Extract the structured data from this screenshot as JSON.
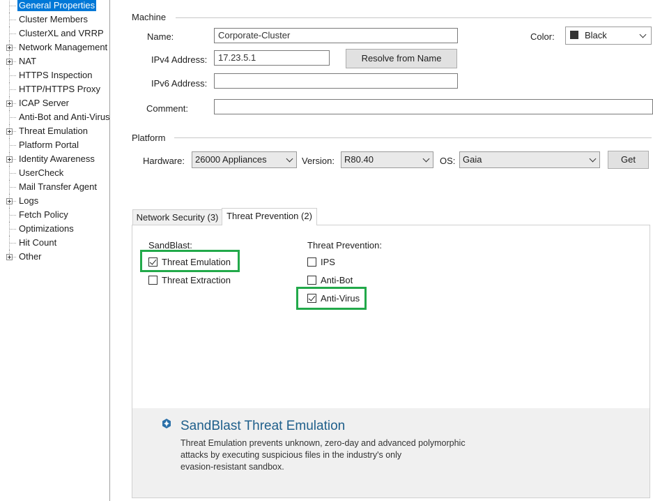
{
  "tree": {
    "items": [
      {
        "label": "General Properties",
        "selected": true,
        "expandable": false
      },
      {
        "label": "Cluster Members",
        "selected": false,
        "expandable": false
      },
      {
        "label": "ClusterXL and VRRP",
        "selected": false,
        "expandable": false
      },
      {
        "label": "Network Management",
        "selected": false,
        "expandable": true
      },
      {
        "label": "NAT",
        "selected": false,
        "expandable": true
      },
      {
        "label": "HTTPS Inspection",
        "selected": false,
        "expandable": false
      },
      {
        "label": "HTTP/HTTPS Proxy",
        "selected": false,
        "expandable": false
      },
      {
        "label": "ICAP Server",
        "selected": false,
        "expandable": true
      },
      {
        "label": "Anti-Bot and Anti-Virus",
        "selected": false,
        "expandable": false
      },
      {
        "label": "Threat Emulation",
        "selected": false,
        "expandable": true
      },
      {
        "label": "Platform Portal",
        "selected": false,
        "expandable": false
      },
      {
        "label": "Identity Awareness",
        "selected": false,
        "expandable": true
      },
      {
        "label": "UserCheck",
        "selected": false,
        "expandable": false
      },
      {
        "label": "Mail Transfer Agent",
        "selected": false,
        "expandable": false
      },
      {
        "label": "Logs",
        "selected": false,
        "expandable": true
      },
      {
        "label": "Fetch Policy",
        "selected": false,
        "expandable": false
      },
      {
        "label": "Optimizations",
        "selected": false,
        "expandable": false
      },
      {
        "label": "Hit Count",
        "selected": false,
        "expandable": false
      },
      {
        "label": "Other",
        "selected": false,
        "expandable": true
      }
    ]
  },
  "machine": {
    "section_title": "Machine",
    "name_label": "Name:",
    "name_value": "Corporate-Cluster",
    "ipv4_label": "IPv4 Address:",
    "ipv4_value": "17.23.5.1",
    "resolve_button": "Resolve from Name",
    "ipv6_label": "IPv6 Address:",
    "ipv6_value": "",
    "comment_label": "Comment:",
    "comment_value": "",
    "color_label": "Color:",
    "color_value": "Black",
    "color_swatch": "#333333"
  },
  "platform": {
    "section_title": "Platform",
    "hardware_label": "Hardware:",
    "hardware_value": "26000 Appliances",
    "version_label": "Version:",
    "version_value": "R80.40",
    "os_label": "OS:",
    "os_value": "Gaia",
    "get_button": "Get"
  },
  "tabs": [
    {
      "label": "Network Security (3)",
      "active": false
    },
    {
      "label": "Threat Prevention (2)",
      "active": true
    }
  ],
  "sandblast": {
    "heading": "SandBlast:",
    "options": [
      {
        "label": "Threat Emulation",
        "checked": true,
        "highlighted": true
      },
      {
        "label": "Threat Extraction",
        "checked": false,
        "highlighted": false
      }
    ]
  },
  "threat_prevention": {
    "heading": "Threat Prevention:",
    "options": [
      {
        "label": "IPS",
        "checked": false,
        "highlighted": false
      },
      {
        "label": "Anti-Bot",
        "checked": false,
        "highlighted": false
      },
      {
        "label": "Anti-Virus",
        "checked": true,
        "highlighted": true
      }
    ]
  },
  "info": {
    "icon": "sandblast-icon",
    "title": "SandBlast Threat Emulation",
    "line1": "Threat Emulation prevents unknown, zero-day and advanced polymorphic",
    "line2": "attacks by executing suspicious files in the industry's only",
    "line3": "evasion-resistant sandbox."
  },
  "colors": {
    "selection": "#0078d7",
    "highlight": "#22a94a",
    "info_title": "#1f5f8b"
  }
}
